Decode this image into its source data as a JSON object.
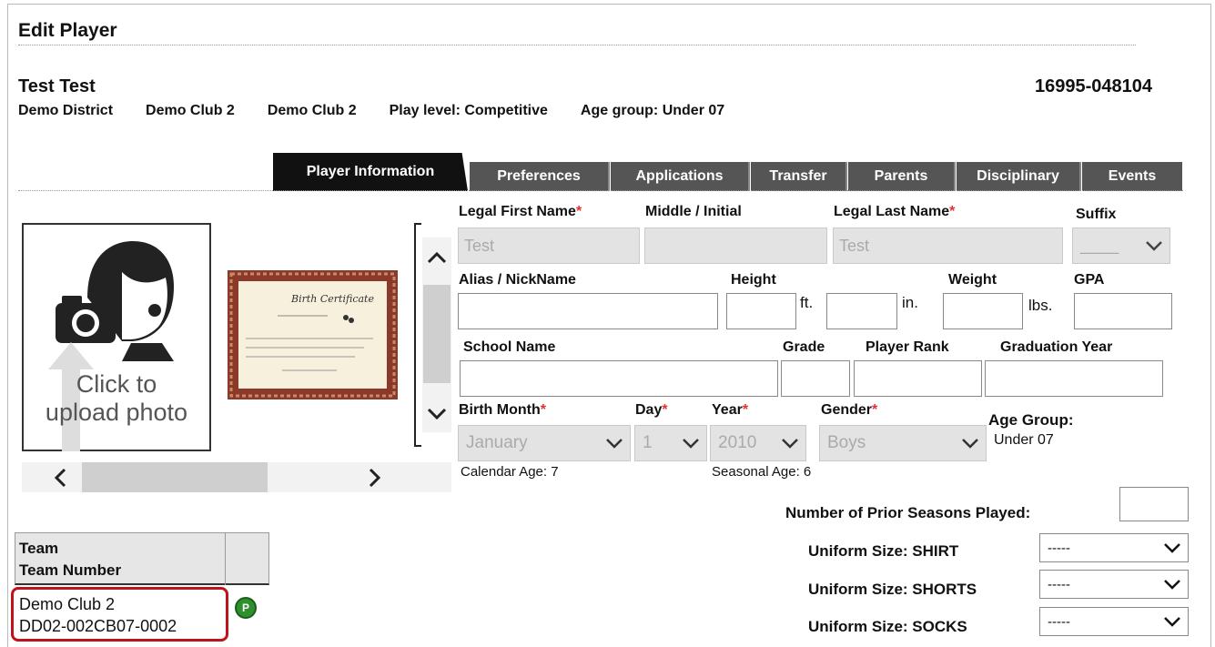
{
  "page": {
    "title": "Edit Player"
  },
  "player": {
    "name": "Test Test",
    "id": "16995-048104",
    "district": "Demo District",
    "club1": "Demo Club 2",
    "club2": "Demo Club 2",
    "play_level": "Play level: Competitive",
    "age_group": "Age group: Under 07"
  },
  "tabs": [
    {
      "label": "Player Information",
      "active": true
    },
    {
      "label": "Preferences"
    },
    {
      "label": "Applications"
    },
    {
      "label": "Transfer"
    },
    {
      "label": "Parents"
    },
    {
      "label": "Disciplinary"
    },
    {
      "label": "Events"
    }
  ],
  "photo": {
    "upload_line1": "Click to",
    "upload_line2": "upload photo"
  },
  "form": {
    "legal_first_name": {
      "label": "Legal First Name",
      "value": "Test"
    },
    "middle_initial": {
      "label": "Middle / Initial",
      "value": ""
    },
    "legal_last_name": {
      "label": "Legal Last Name",
      "value": "Test"
    },
    "suffix": {
      "label": "Suffix",
      "value": "____"
    },
    "alias": {
      "label": "Alias / NickName",
      "value": ""
    },
    "height": {
      "label": "Height",
      "ft_unit": "ft.",
      "in_unit": "in."
    },
    "weight": {
      "label": "Weight",
      "unit": "lbs."
    },
    "gpa": {
      "label": "GPA"
    },
    "school_name": {
      "label": "School Name"
    },
    "grade": {
      "label": "Grade"
    },
    "player_rank": {
      "label": "Player Rank"
    },
    "graduation_year": {
      "label": "Graduation Year"
    },
    "birth_month": {
      "label": "Birth Month",
      "value": "January"
    },
    "day": {
      "label": "Day",
      "value": "1"
    },
    "year": {
      "label": "Year",
      "value": "2010"
    },
    "gender": {
      "label": "Gender",
      "value": "Boys"
    },
    "age_group": {
      "label": "Age Group:",
      "value": "Under 07"
    },
    "calendar_age": "Calendar Age: 7",
    "seasonal_age": "Seasonal Age: 6",
    "required_mark": "*"
  },
  "uniform": {
    "prior_seasons_label": "Number of Prior Seasons Played:",
    "shirt_label": "Uniform Size: SHIRT",
    "shorts_label": "Uniform Size: SHORTS",
    "socks_label": "Uniform Size: SOCKS",
    "shirt_value": "-----",
    "shorts_value": "-----",
    "socks_value": "-----"
  },
  "team_table": {
    "header_team": "Team",
    "header_number": "Team Number",
    "row_team": "Demo Club 2",
    "row_number": "DD02-002CB07-0002",
    "badge": "P"
  },
  "colors": {
    "active_tab": "#111111",
    "tab": "#555555",
    "required": "#e53030",
    "highlight": "#c0121b",
    "badge": "#2f8f2f"
  }
}
